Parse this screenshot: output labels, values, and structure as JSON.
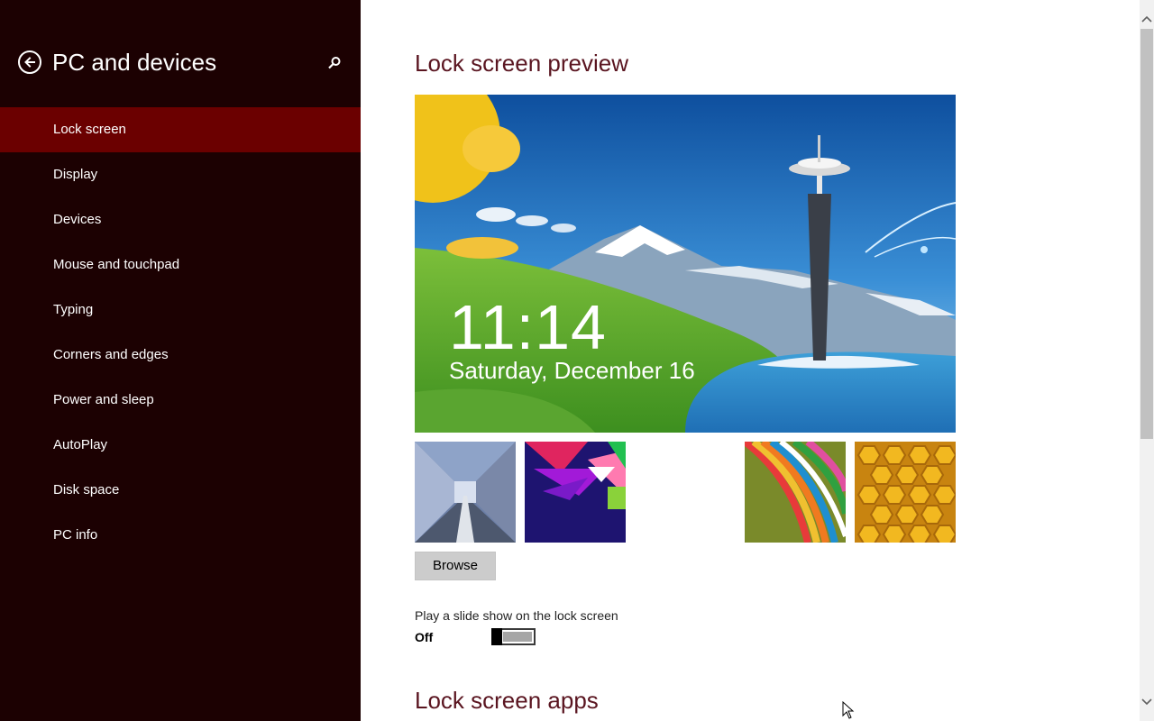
{
  "sidebar": {
    "title": "PC and devices",
    "back_icon": "back-arrow-icon",
    "search_icon": "search-icon",
    "items": [
      {
        "label": "Lock screen",
        "active": true
      },
      {
        "label": "Display"
      },
      {
        "label": "Devices"
      },
      {
        "label": "Mouse and touchpad"
      },
      {
        "label": "Typing"
      },
      {
        "label": "Corners and edges"
      },
      {
        "label": "Power and sleep"
      },
      {
        "label": "AutoPlay"
      },
      {
        "label": "Disk space"
      },
      {
        "label": "PC info"
      }
    ]
  },
  "main": {
    "preview_title": "Lock screen preview",
    "preview": {
      "time": "11:14",
      "date": "Saturday, December 16"
    },
    "browse_label": "Browse",
    "slideshow": {
      "label": "Play a slide show on the lock screen",
      "state": "Off"
    },
    "apps_title": "Lock screen apps"
  },
  "colors": {
    "sidebar_bg": "#1c0102",
    "sidebar_active": "#6b0000",
    "heading": "#5a1520"
  }
}
